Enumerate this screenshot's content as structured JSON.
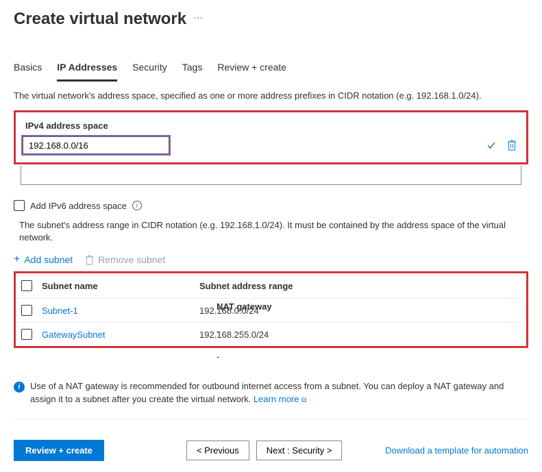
{
  "header": {
    "title": "Create virtual network"
  },
  "tabs": {
    "basics": "Basics",
    "ip_addresses": "IP Addresses",
    "security": "Security",
    "tags": "Tags",
    "review": "Review + create"
  },
  "description": "The virtual network's address space, specified as one or more address prefixes in CIDR notation (e.g. 192.168.1.0/24).",
  "ipv4": {
    "label": "IPv4 address space",
    "value": "192.168.0.0/16"
  },
  "ipv6": {
    "label": "Add IPv6 address space"
  },
  "subnet": {
    "description": "The subnet's address range in CIDR notation (e.g. 192.168.1.0/24). It must be contained by the address space of the virtual network.",
    "add_label": "Add subnet",
    "remove_label": "Remove subnet",
    "columns": {
      "name": "Subnet name",
      "range": "Subnet address range",
      "nat": "NAT gateway"
    },
    "rows": [
      {
        "name": "Subnet-1",
        "range": "192.168.0.0/24",
        "nat": "-"
      },
      {
        "name": "GatewaySubnet",
        "range": "192.168.255.0/24",
        "nat": "-"
      }
    ]
  },
  "info_banner": {
    "text": "Use of a NAT gateway is recommended for outbound internet access from a subnet. You can deploy a NAT gateway and assign it to a subnet after you create the virtual network. ",
    "learn_more": "Learn more"
  },
  "footer": {
    "review": "Review + create",
    "previous": "< Previous",
    "next": "Next : Security >",
    "download": "Download a template for automation"
  }
}
